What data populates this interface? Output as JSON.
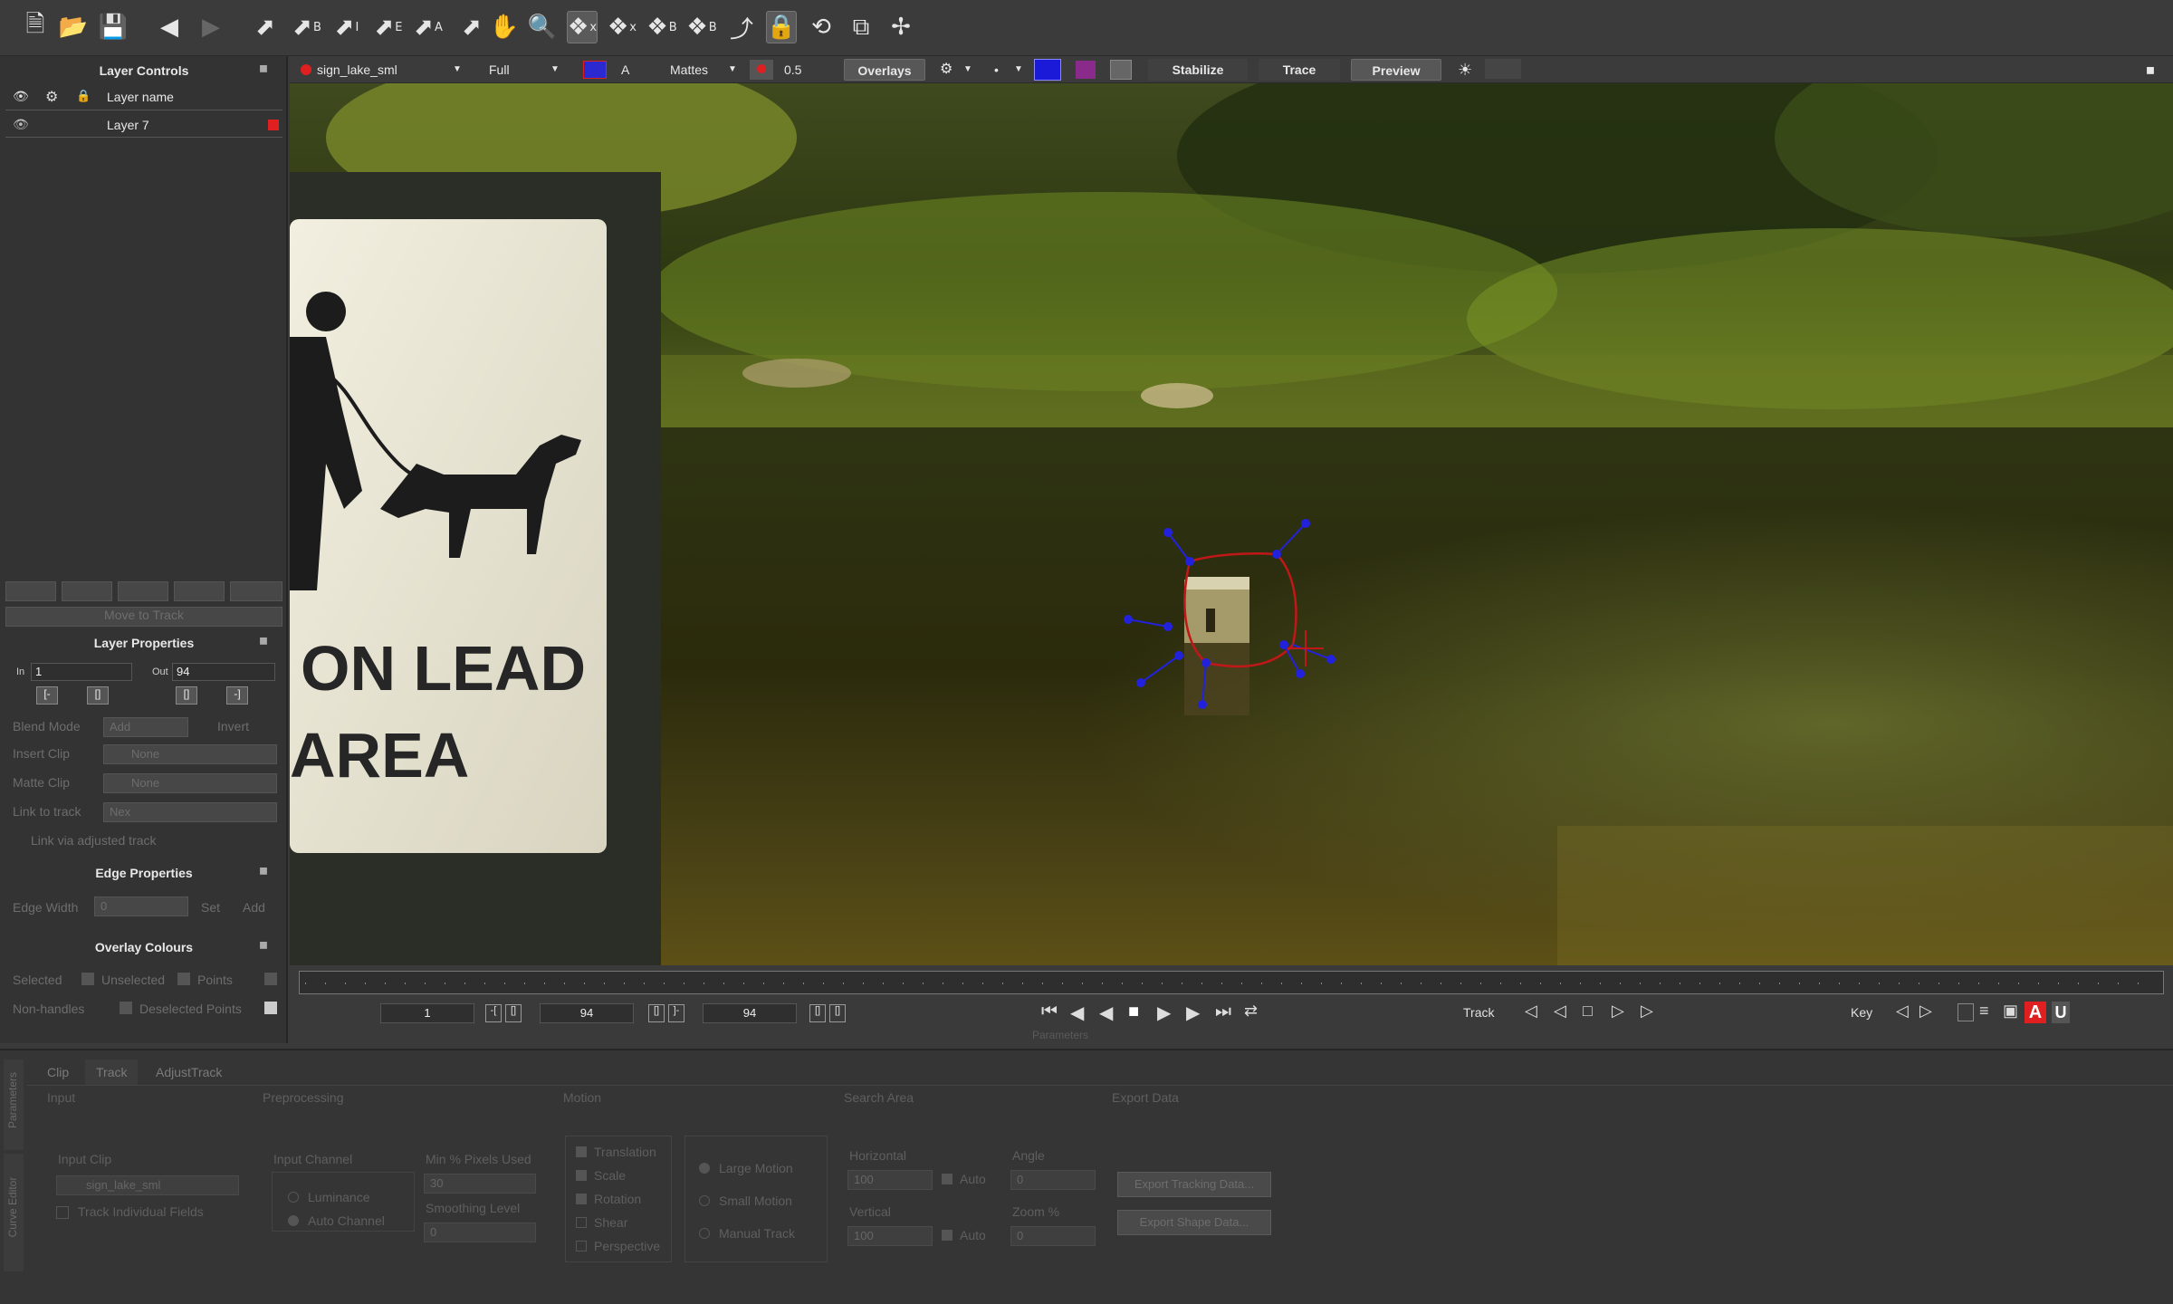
{
  "toolbar": {
    "tools": [
      "new-file",
      "open-file",
      "save-file",
      "undo",
      "redo",
      "select",
      "select-b",
      "select-i",
      "select-e",
      "select-a",
      "add-point",
      "hand",
      "zoom",
      "shape-x",
      "shape-x2",
      "shape-b",
      "shape-b2",
      "curve",
      "lock",
      "rotate",
      "scale",
      "move"
    ],
    "shape_x_sup": "x",
    "shape_x2_sup": "x",
    "shape_b_sup": "B",
    "shape_b2_sup": "B",
    "select_b_sup": "B",
    "select_i_sup": "I",
    "select_e_sup": "E",
    "select_a_sup": "A"
  },
  "layer_controls": {
    "title": "Layer Controls",
    "header_label": "Layer name",
    "layers": [
      {
        "name": "Layer 7",
        "color": "#e02020"
      }
    ],
    "dim_button": "Move to Track"
  },
  "layer_properties": {
    "title": "Layer Properties",
    "in_label": "In",
    "in_value": "1",
    "out_label": "Out",
    "out_value": "94",
    "blend_mode_label": "Blend Mode",
    "blend_mode_value": "Add",
    "invert_label": "Invert",
    "insert_clip_label": "Insert Clip",
    "insert_clip_value": "None",
    "matte_clip_label": "Matte Clip",
    "matte_clip_value": "None",
    "link_to_track_label": "Link to track",
    "link_to_track_value": "Nex",
    "link_adjusted_label": "Link via adjusted track"
  },
  "edge_properties": {
    "title": "Edge Properties",
    "edge_width_label": "Edge Width",
    "edge_width_value": "0",
    "set_label": "Set",
    "add_label": "Add"
  },
  "overlay_colours": {
    "title": "Overlay Colours",
    "selected_label": "Selected",
    "unselected_label": "Unselected",
    "points_label": "Points",
    "nonhandles_label": "Non-handles",
    "deselected_label": "Deselected Points"
  },
  "viewer_toolbar": {
    "clip_name": "sign_lake_sml",
    "resolution": "Full",
    "mattes_label": "Mattes",
    "opacity_value": "0.5",
    "overlays_label": "Overlays",
    "stabilize_label": "Stabilize",
    "trace_label": "Trace",
    "preview_label": "Preview",
    "a_label": "A"
  },
  "viewer": {
    "sign_text_1": "ON LEAD",
    "sign_text_2": "AREA"
  },
  "timeline": {
    "start_frame": "1",
    "end_frame": "94",
    "current_frame": "94",
    "parameters_label": "Parameters",
    "track_label": "Track",
    "key_label": "Key",
    "key_a_label": "A",
    "key_u_label": "U"
  },
  "bottom_panel": {
    "tabs": [
      "Clip",
      "Track",
      "AdjustTrack"
    ],
    "side_tabs": [
      "Parameters",
      "Curve Editor"
    ],
    "section_input": "Input",
    "section_preprocessing": "Preprocessing",
    "section_motion": "Motion",
    "section_search_area": "Search Area",
    "section_export_data": "Export Data",
    "input_clip_label": "Input Clip",
    "input_clip_value": "sign_lake_sml",
    "track_individual_fields": "Track Individual Fields",
    "input_channel_label": "Input Channel",
    "luminance_label": "Luminance",
    "auto_channel_label": "Auto Channel",
    "min_pixels_label": "Min % Pixels Used",
    "min_pixels_value": "30",
    "smoothing_label": "Smoothing Level",
    "smoothing_value": "0",
    "motion_translation": "Translation",
    "motion_scale": "Scale",
    "motion_rotation": "Rotation",
    "motion_shear": "Shear",
    "motion_perspective": "Perspective",
    "large_motion": "Large Motion",
    "small_motion": "Small Motion",
    "manual_track": "Manual Track",
    "horizontal_label": "Horizontal",
    "horizontal_value": "100",
    "vertical_label": "Vertical",
    "vertical_value": "100",
    "auto_label": "Auto",
    "angle_label": "Angle",
    "angle_value": "0",
    "zoom_label": "Zoom %",
    "zoom_value": "0",
    "export_tracking_button": "Export Tracking Data...",
    "export_shape_button": "Export Shape Data..."
  }
}
